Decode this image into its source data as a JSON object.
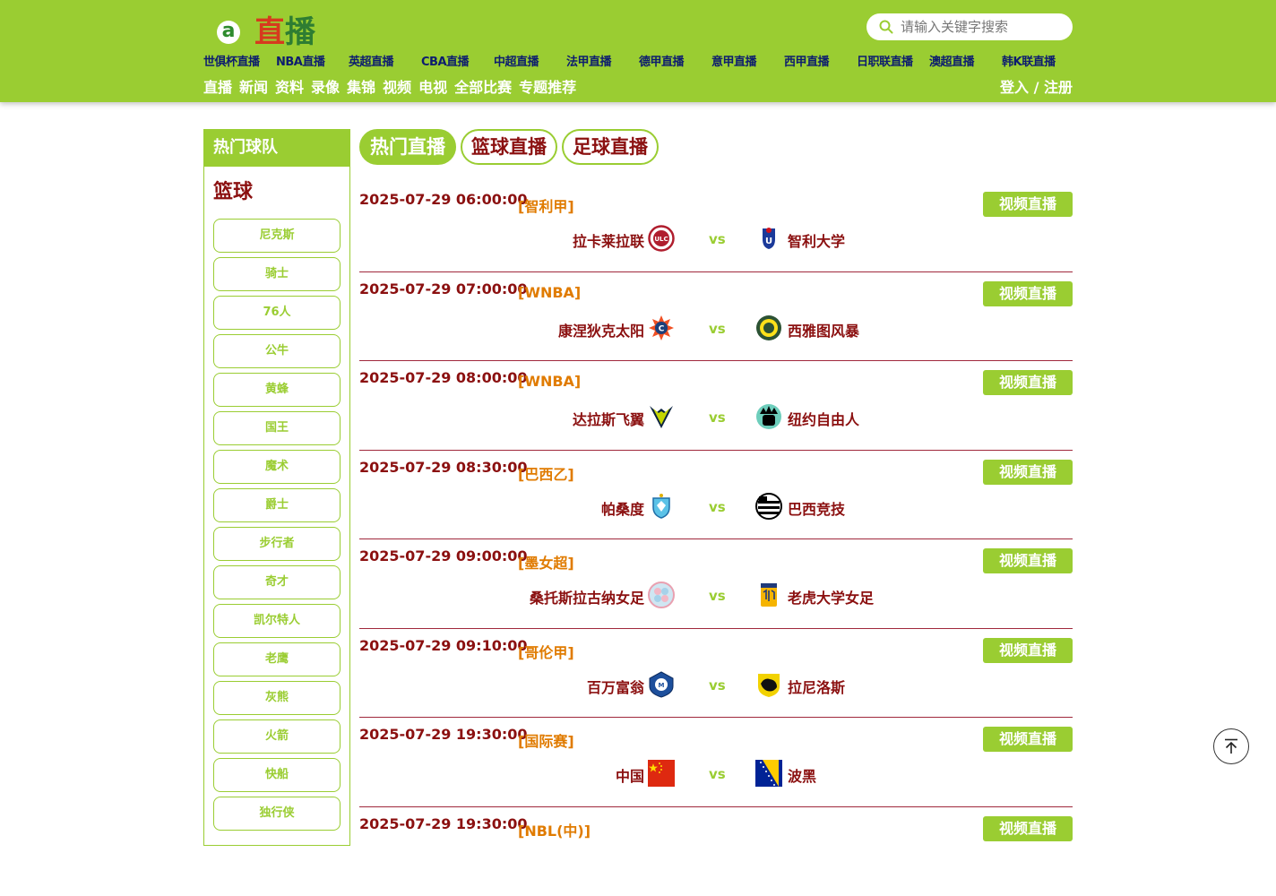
{
  "header": {
    "logo_a": "a",
    "logo_zhi": "直",
    "logo_bo": "播",
    "search_placeholder": "请输入关键字搜索",
    "nav_primary": [
      "世俱杯直播",
      "NBA直播",
      "英超直播",
      "CBA直播",
      "中超直播",
      "法甲直播",
      "德甲直播",
      "意甲直播",
      "西甲直播",
      "日职联直播",
      "澳超直播",
      "韩K联直播"
    ],
    "nav_secondary": [
      "直播",
      "新闻",
      "资料",
      "录像",
      "集锦",
      "视频",
      "电视",
      "全部比赛",
      "专题推荐"
    ],
    "login": "登入",
    "login_sep": " / ",
    "register": "注册"
  },
  "sidebar": {
    "title": "热门球队",
    "category": "篮球",
    "teams": [
      "尼克斯",
      "骑士",
      "76人",
      "公牛",
      "黄蜂",
      "国王",
      "魔术",
      "爵士",
      "步行者",
      "奇才",
      "凯尔特人",
      "老鹰",
      "灰熊",
      "火箭",
      "快船",
      "独行侠"
    ]
  },
  "tabs": [
    "热门直播",
    "篮球直播",
    "足球直播"
  ],
  "colors": {
    "brand_green": "#9acd32",
    "dark_red": "#8b1010",
    "league_orange": "#e07b00",
    "nav_blue": "#0d1d6e"
  },
  "matches": [
    {
      "time": "2025-07-29 06:00:00",
      "league": "[智利甲]",
      "home": "拉卡莱拉联",
      "away": "智利大学",
      "vs": "vs",
      "button": "视频直播",
      "home_icon": "unión-la-calera-crest",
      "away_icon": "universidad-de-chile-crest"
    },
    {
      "time": "2025-07-29 07:00:00",
      "league": "[WNBA]",
      "home": "康涅狄克太阳",
      "away": "西雅图风暴",
      "vs": "vs",
      "button": "视频直播",
      "home_icon": "connecticut-sun-logo",
      "away_icon": "seattle-storm-logo"
    },
    {
      "time": "2025-07-29 08:00:00",
      "league": "[WNBA]",
      "home": "达拉斯飞翼",
      "away": "纽约自由人",
      "vs": "vs",
      "button": "视频直播",
      "home_icon": "dallas-wings-logo",
      "away_icon": "new-york-liberty-logo"
    },
    {
      "time": "2025-07-29 08:30:00",
      "league": "[巴西乙]",
      "home": "帕桑度",
      "away": "巴西竞技",
      "vs": "vs",
      "button": "视频直播",
      "home_icon": "paysandu-crest",
      "away_icon": "atletico-crest"
    },
    {
      "time": "2025-07-29 09:00:00",
      "league": "[墨女超]",
      "home": "桑托斯拉古纳女足",
      "away": "老虎大学女足",
      "vs": "vs",
      "button": "视频直播",
      "home_icon": "santos-laguna-crest",
      "away_icon": "tigres-crest"
    },
    {
      "time": "2025-07-29 09:10:00",
      "league": "[哥伦甲]",
      "home": "百万富翁",
      "away": "拉尼洛斯",
      "vs": "vs",
      "button": "视频直播",
      "home_icon": "millonarios-crest",
      "away_icon": "llaneros-crest"
    },
    {
      "time": "2025-07-29 19:30:00",
      "league": "[国际赛]",
      "home": "中国",
      "away": "波黑",
      "vs": "vs",
      "button": "视频直播",
      "home_icon": "china-flag",
      "away_icon": "bosnia-flag"
    },
    {
      "time": "2025-07-29 19:30:00",
      "league": "[NBL(中)]",
      "home": "",
      "away": "",
      "vs": "",
      "button": "视频直播",
      "home_icon": "",
      "away_icon": ""
    }
  ]
}
